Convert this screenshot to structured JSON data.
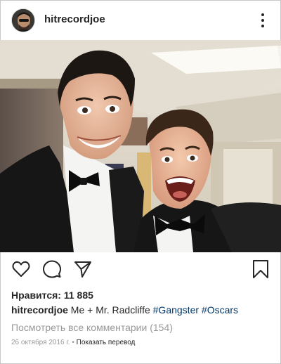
{
  "post": {
    "username": "hitrecordjoe",
    "likes_text": "Нравится: 11 885",
    "caption": {
      "username": "hitrecordjoe",
      "text": "Me + Mr. Radcliffe",
      "hashtags": [
        "#Gangster",
        "#Oscars"
      ]
    },
    "view_comments": "Посмотреть все комментарии (154)",
    "date": "26 октября 2016 г.",
    "separator": "•",
    "translate": "Показать перевод"
  },
  "icons": {
    "header": [
      "avatar",
      "more-options-icon"
    ],
    "actions_left": [
      "heart-icon",
      "comment-icon",
      "share-icon"
    ],
    "actions_right": [
      "bookmark-icon"
    ]
  },
  "colors": {
    "text": "#262626",
    "hashtag": "#003569",
    "muted": "#999999"
  }
}
